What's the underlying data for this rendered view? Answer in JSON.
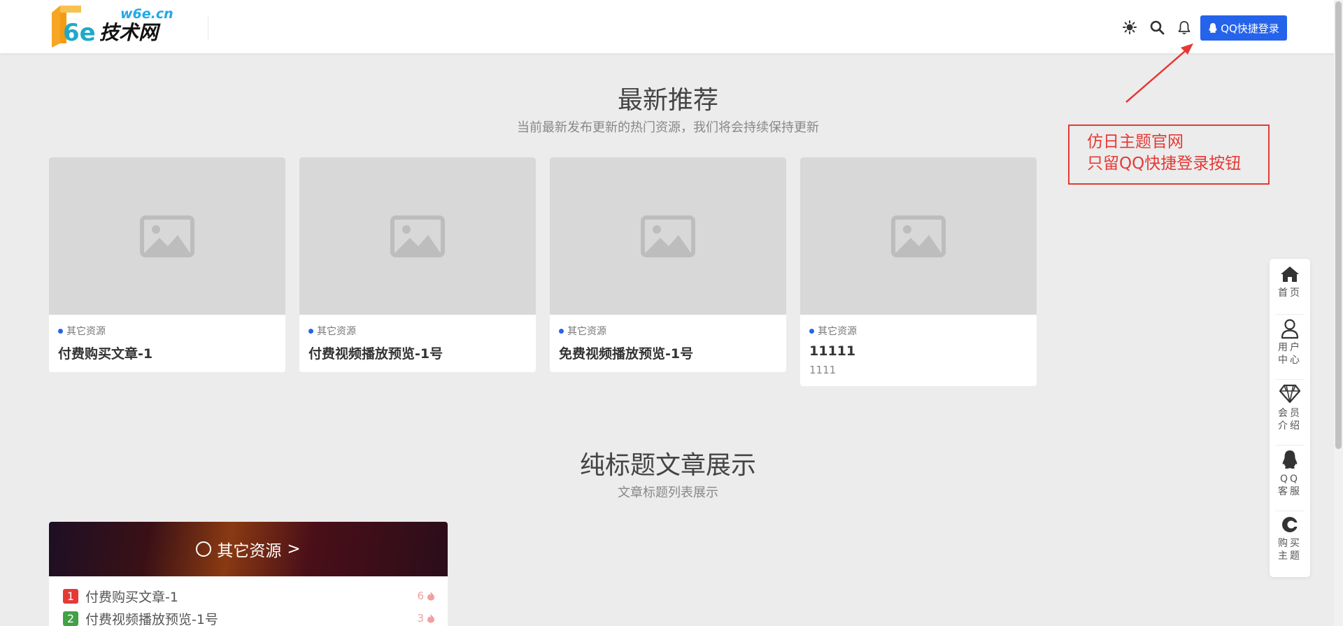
{
  "header": {
    "logo": {
      "domain_text": "w6e.cn",
      "brand_main": "6e",
      "brand_suffix": "技术网"
    },
    "icons": [
      "theme-icon",
      "search-icon",
      "bell-icon"
    ],
    "login_button": "QQ快捷登录"
  },
  "annotation": {
    "line1": "仿日主题官网",
    "line2": "只留QQ快捷登录按钮"
  },
  "latest": {
    "title": "最新推荐",
    "subtitle": "当前最新发布更新的热门资源，我们将会持续保持更新",
    "cards": [
      {
        "category": "其它资源",
        "title": "付费购买文章-1",
        "desc": ""
      },
      {
        "category": "其它资源",
        "title": "付费视频播放预览-1号",
        "desc": ""
      },
      {
        "category": "其它资源",
        "title": "免费视频播放预览-1号",
        "desc": ""
      },
      {
        "category": "其它资源",
        "title": "11111",
        "desc": "1111"
      }
    ]
  },
  "title_list": {
    "title": "纯标题文章展示",
    "subtitle": "文章标题列表展示",
    "block": {
      "header": "其它资源",
      "arrow": ">",
      "rows": [
        {
          "rank": "1",
          "title": "付费购买文章-1",
          "count": "6"
        },
        {
          "rank": "2",
          "title": "付费视频播放预览-1号",
          "count": "3"
        }
      ]
    }
  },
  "sidebar": {
    "items": [
      {
        "icon": "home-icon",
        "label": "首页"
      },
      {
        "icon": "user-icon",
        "label": "用户中心"
      },
      {
        "icon": "diamond-icon",
        "label": "会员介绍"
      },
      {
        "icon": "qq-icon",
        "label": "QQ客服"
      },
      {
        "icon": "cart-icon",
        "label": "购买主题"
      }
    ]
  },
  "colors": {
    "accent": "#2563eb",
    "annotation": "#e53935",
    "background": "#ececec",
    "rank_1": "#e53935",
    "rank_2": "#43a047"
  }
}
